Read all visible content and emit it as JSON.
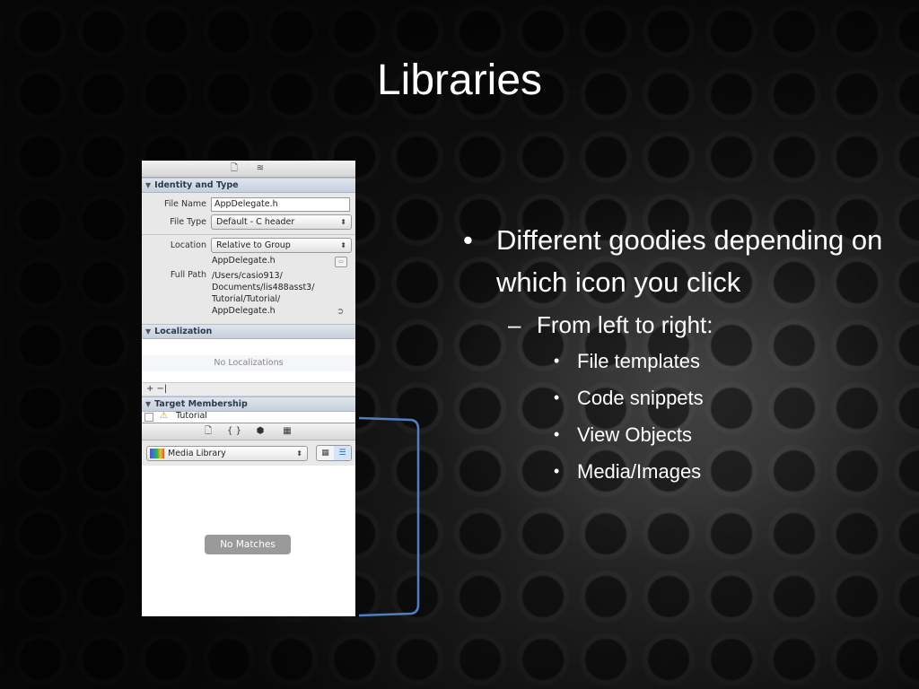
{
  "slide": {
    "title": "Libraries",
    "bullets": {
      "main": "Different goodies depending on which icon you click",
      "sub": "From left to right:",
      "items": [
        "File templates",
        "Code snippets",
        "View Objects",
        "Media/Images"
      ]
    }
  },
  "inspector": {
    "identity_header": "Identity and Type",
    "file_name_label": "File Name",
    "file_name_value": "AppDelegate.h",
    "file_type_label": "File Type",
    "file_type_value": "Default - C header",
    "location_label": "Location",
    "location_value": "Relative to Group",
    "location_file": "AppDelegate.h",
    "full_path_label": "Full Path",
    "full_path_lines": [
      "/Users/casio913/",
      "Documents/lis488asst3/",
      "Tutorial/Tutorial/",
      "AppDelegate.h"
    ],
    "localization_header": "Localization",
    "no_localizations": "No Localizations",
    "plus_minus": "+ −|",
    "target_header": "Target Membership",
    "target_item": "Tutorial"
  },
  "library": {
    "popup_value": "Media Library",
    "no_matches": "No Matches"
  },
  "colors": {
    "bracket": "#4f7fc0",
    "text": "#ffffff"
  }
}
